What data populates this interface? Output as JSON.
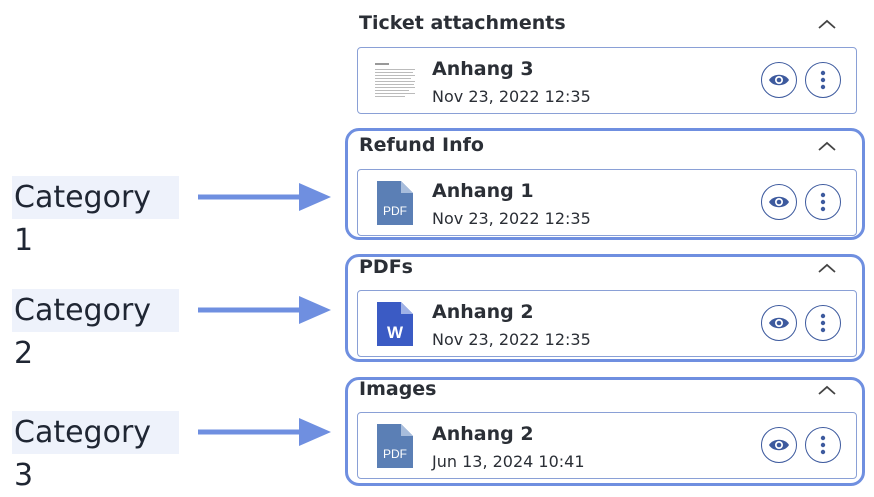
{
  "sections": [
    {
      "title": "Ticket attachments",
      "file_name": "Anhang 3",
      "date": "Nov 23, 2022 12:35",
      "icon": "document-thumbnail-icon"
    },
    {
      "title": "Refund Info",
      "file_name": "Anhang 1",
      "date": "Nov 23, 2022 12:35",
      "icon": "pdf-file-icon"
    },
    {
      "title": "PDFs",
      "file_name": "Anhang 2",
      "date": "Nov 23, 2022 12:35",
      "icon": "word-file-icon"
    },
    {
      "title": "Images",
      "file_name": "Anhang 2",
      "date": "Jun 13, 2024 10:41",
      "icon": "pdf-file-icon"
    }
  ],
  "icon_text": {
    "pdf": "PDF",
    "word": "W"
  },
  "annotations": [
    "Category 1",
    "Category 2",
    "Category 3"
  ],
  "colors": {
    "accent": "#6f8fe0",
    "button_border": "#3d5a9e",
    "pdf_icon": "#5b7fb5",
    "word_icon": "#3b5bc4",
    "label_bg": "#eef2fb"
  }
}
